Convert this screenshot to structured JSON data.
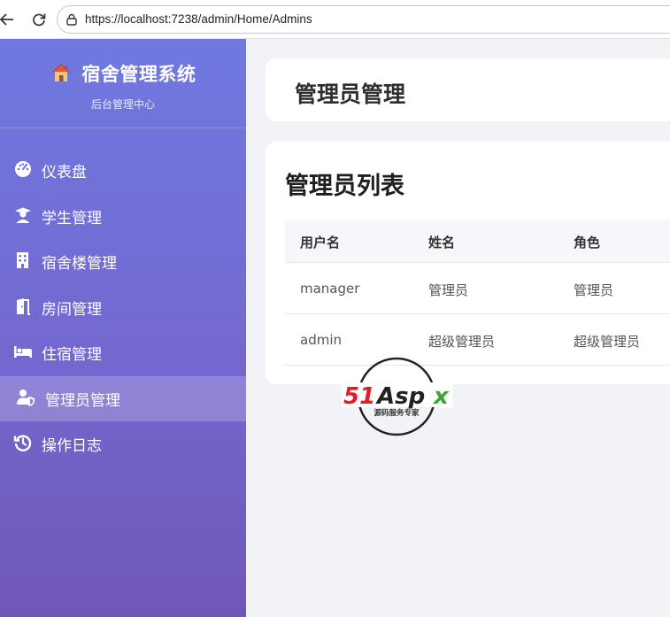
{
  "browser": {
    "url": "https://localhost:7238/admin/Home/Admins"
  },
  "sidebar": {
    "brand_icon": "house-icon",
    "brand_title": "宿舍管理系统",
    "brand_subtitle": "后台管理中心",
    "items": [
      {
        "label": "仪表盘",
        "icon": "dashboard-icon",
        "active": false
      },
      {
        "label": "学生管理",
        "icon": "student-icon",
        "active": false
      },
      {
        "label": "宿舍楼管理",
        "icon": "building-icon",
        "active": false
      },
      {
        "label": "房间管理",
        "icon": "door-icon",
        "active": false
      },
      {
        "label": "住宿管理",
        "icon": "bed-icon",
        "active": false
      },
      {
        "label": "管理员管理",
        "icon": "user-shield-icon",
        "active": true
      },
      {
        "label": "操作日志",
        "icon": "history-icon",
        "active": false
      }
    ]
  },
  "page": {
    "title": "管理员管理"
  },
  "admin_list": {
    "title": "管理员列表",
    "columns": [
      "用户名",
      "姓名",
      "角色"
    ],
    "rows": [
      [
        "manager",
        "管理员",
        "管理员"
      ],
      [
        "admin",
        "超级管理员",
        "超级管理员"
      ]
    ]
  },
  "watermark": {
    "brand": "51Aspx",
    "tagline": "源码服务专家"
  },
  "colors": {
    "sidebar_top": "#6f79e0",
    "sidebar_bottom": "#6f57b6",
    "background": "#f2f3f6"
  }
}
